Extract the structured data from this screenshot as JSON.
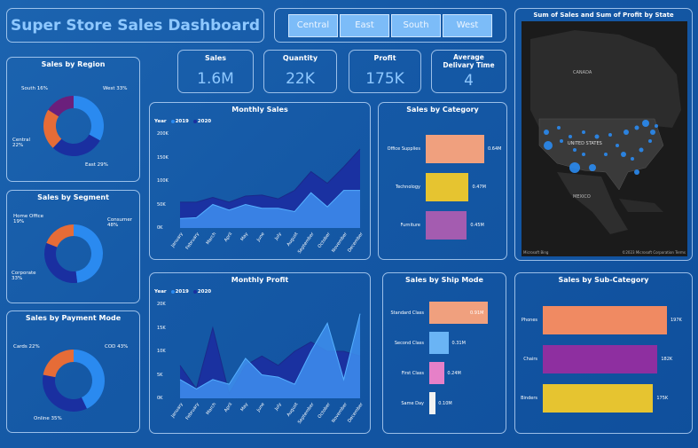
{
  "title": "Super Store Sales Dashboard",
  "region_tabs": [
    "Central",
    "East",
    "South",
    "West"
  ],
  "kpis": [
    {
      "label": "Sales",
      "value": "1.6M"
    },
    {
      "label": "Quantity",
      "value": "22K"
    },
    {
      "label": "Profit",
      "value": "175K"
    },
    {
      "label": "Average Delivary Time",
      "value": "4"
    }
  ],
  "map": {
    "title": "Sum of Sales and Sum of Profit by State",
    "labels": {
      "canada": "CANADA",
      "us": "UNITED STATES",
      "mexico": "MEXICO"
    },
    "attribution_left": "Microsoft Bing",
    "attribution_right": "©2023 Microsoft Corporation  Terms"
  },
  "colors": {
    "dark_blue": "#1a2fa0",
    "mid_blue": "#2a8af0",
    "orange": "#e66c37",
    "purple": "#6b1f7c",
    "light_blue": "#3f9cf7"
  },
  "chart_data": [
    {
      "id": "sales_by_region",
      "type": "pie",
      "title": "Sales by Region",
      "labels": [
        "West 33%",
        "East 29%",
        "Central 22%",
        "South 16%"
      ],
      "values": [
        33,
        29,
        22,
        16
      ],
      "colors": [
        "#2a8af0",
        "#1a2fa0",
        "#e66c37",
        "#6b1f7c"
      ]
    },
    {
      "id": "sales_by_segment",
      "type": "pie",
      "title": "Sales by Segment",
      "labels": [
        "Consumer 48%",
        "Corporate 33%",
        "Home Office 19%"
      ],
      "values": [
        48,
        33,
        19
      ],
      "colors": [
        "#2a8af0",
        "#1a2fa0",
        "#e66c37"
      ]
    },
    {
      "id": "sales_by_payment",
      "type": "pie",
      "title": "Sales by Payment Mode",
      "labels": [
        "COD 43%",
        "Online 35%",
        "Cards 22%"
      ],
      "values": [
        43,
        35,
        22
      ],
      "colors": [
        "#2a8af0",
        "#1a2fa0",
        "#e66c37"
      ]
    },
    {
      "id": "monthly_sales",
      "type": "area",
      "title": "Monthly Sales",
      "legend_title": "Year",
      "x": [
        "January",
        "February",
        "March",
        "April",
        "May",
        "June",
        "July",
        "August",
        "September",
        "October",
        "November",
        "December"
      ],
      "series": [
        {
          "name": "2019",
          "values": [
            20000,
            22000,
            50000,
            38000,
            50000,
            42000,
            42000,
            35000,
            75000,
            45000,
            80000,
            80000
          ]
        },
        {
          "name": "2020",
          "values": [
            55000,
            55000,
            65000,
            55000,
            68000,
            70000,
            62000,
            80000,
            120000,
            95000,
            130000,
            168000
          ]
        }
      ],
      "y_ticks": [
        "0K",
        "50K",
        "100K",
        "150K",
        "200K"
      ],
      "ylim": [
        0,
        200000
      ]
    },
    {
      "id": "monthly_profit",
      "type": "area",
      "title": "Monthly Profit",
      "legend_title": "Year",
      "x": [
        "January",
        "February",
        "March",
        "April",
        "May",
        "June",
        "July",
        "August",
        "September",
        "October",
        "November",
        "December"
      ],
      "series": [
        {
          "name": "2019",
          "values": [
            4000,
            2000,
            4000,
            3000,
            8500,
            5000,
            4500,
            3000,
            10000,
            16000,
            4000,
            18000
          ]
        },
        {
          "name": "2020",
          "values": [
            7000,
            2000,
            15000,
            1000,
            7000,
            9000,
            7000,
            10000,
            12000,
            10000,
            10000,
            9000
          ]
        }
      ],
      "y_ticks": [
        "0K",
        "5K",
        "10K",
        "15K",
        "20K"
      ],
      "ylim": [
        0,
        20000
      ]
    },
    {
      "id": "sales_by_category",
      "type": "bar",
      "title": "Sales by Category",
      "categories": [
        "Office Supplies",
        "Technology",
        "Furniture"
      ],
      "values": [
        0.64,
        0.47,
        0.45
      ],
      "value_labels": [
        "0.64M",
        "0.47M",
        "0.45M"
      ],
      "colors": [
        "#f0a07e",
        "#e6c430",
        "#a45cb0"
      ]
    },
    {
      "id": "sales_by_ship_mode",
      "type": "bar",
      "title": "Sales by Ship Mode",
      "categories": [
        "Standard Class",
        "Second Class",
        "First Class",
        "Same Day"
      ],
      "values": [
        0.91,
        0.31,
        0.24,
        0.1
      ],
      "value_labels": [
        "0.91M",
        "0.31M",
        "0.24M",
        "0.10M"
      ],
      "colors": [
        "#f0a07e",
        "#6ab4f5",
        "#e680c8",
        "#f2f2f2"
      ]
    },
    {
      "id": "sales_by_subcategory",
      "type": "bar",
      "title": "Sales by Sub-Category",
      "categories": [
        "Phones",
        "Chairs",
        "Binders"
      ],
      "values": [
        197,
        182,
        175
      ],
      "value_labels": [
        "197K",
        "182K",
        "175K"
      ],
      "colors": [
        "#f08a62",
        "#8e2fa0",
        "#e6c430"
      ]
    }
  ]
}
